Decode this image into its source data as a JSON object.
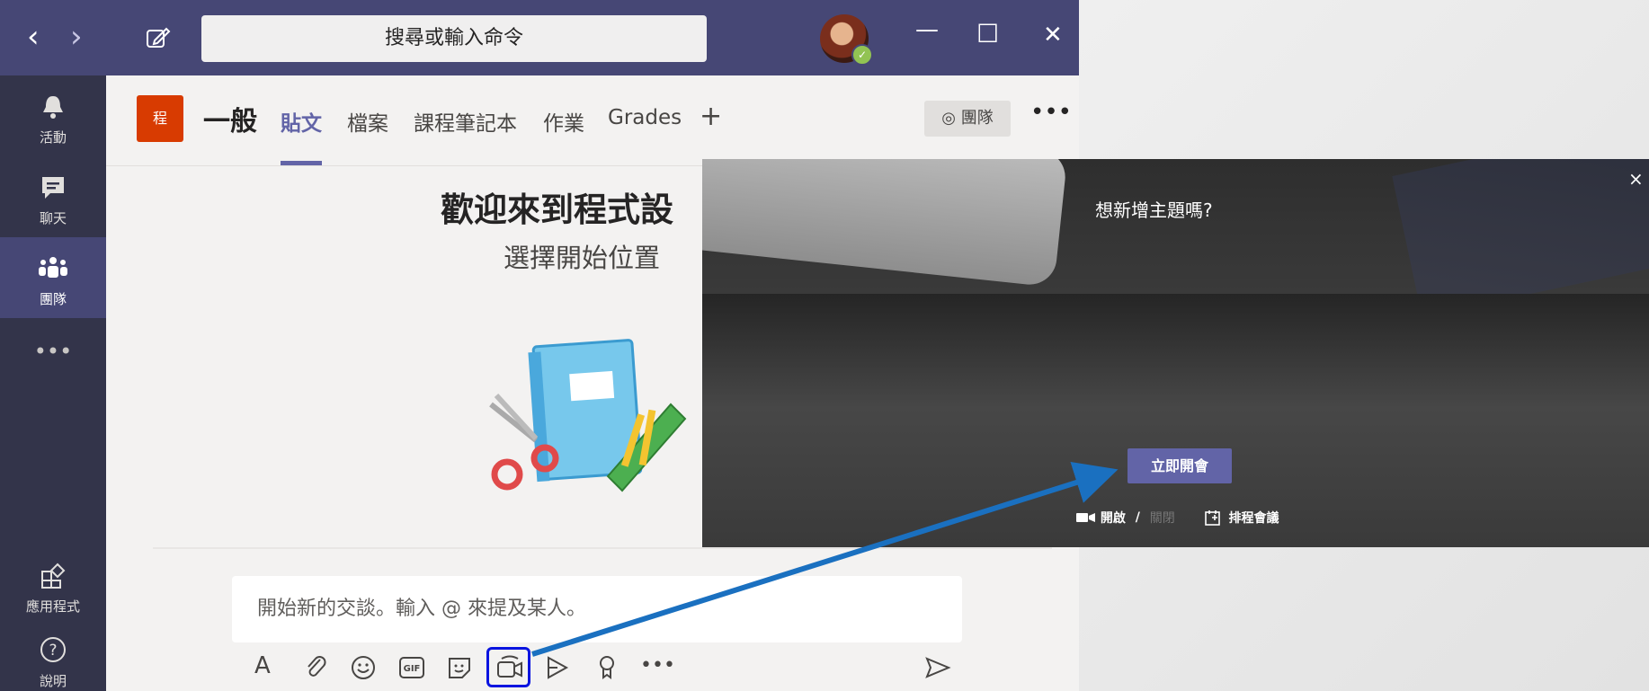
{
  "titlebar": {
    "back_icon": "‹",
    "forward_icon": "›",
    "compose_icon": "compose-icon",
    "search_placeholder": "搜尋或輸入命令",
    "minimize_icon": "—",
    "maximize_icon": "☐",
    "close_icon": "✕"
  },
  "rail": {
    "items": [
      {
        "label": "活動",
        "icon": "🔔"
      },
      {
        "label": "聊天",
        "icon": "💬"
      },
      {
        "label": "團隊",
        "icon": "👥"
      },
      {
        "label": "",
        "icon": "•••"
      },
      {
        "label": "應用程式",
        "icon": "⊞"
      },
      {
        "label": "說明",
        "icon": "?"
      }
    ]
  },
  "channel": {
    "team_tile": "程",
    "name": "一般",
    "tabs": [
      "貼文",
      "檔案",
      "課程筆記本",
      "作業",
      "Grades"
    ],
    "add_tab": "+",
    "team_button": "團隊",
    "more": "•••"
  },
  "welcome": {
    "title": "歡迎來到程式設",
    "subtitle": "選擇開始位置"
  },
  "compose": {
    "placeholder": "開始新的交談。輸入 @ 來提及某人。",
    "toolbar": {
      "format": "A",
      "attach": "📎",
      "emoji": "☺",
      "gif": "GIF",
      "sticker": "▣",
      "meet": "🎥",
      "stream": "▷",
      "praise": "♀",
      "more": "•••",
      "send": "➤"
    }
  },
  "meeting": {
    "question": "想新增主題嗎?",
    "meet_now": "立即開會",
    "camera_on": "開啟",
    "separator": "/",
    "camera_off": "關閉",
    "schedule": "排程會議",
    "close": "×"
  },
  "colors": {
    "titlebar": "#464775",
    "rail": "#33344a",
    "accent": "#6264a7",
    "arrow": "#1a70c0",
    "highlight": "#0a14e0"
  }
}
